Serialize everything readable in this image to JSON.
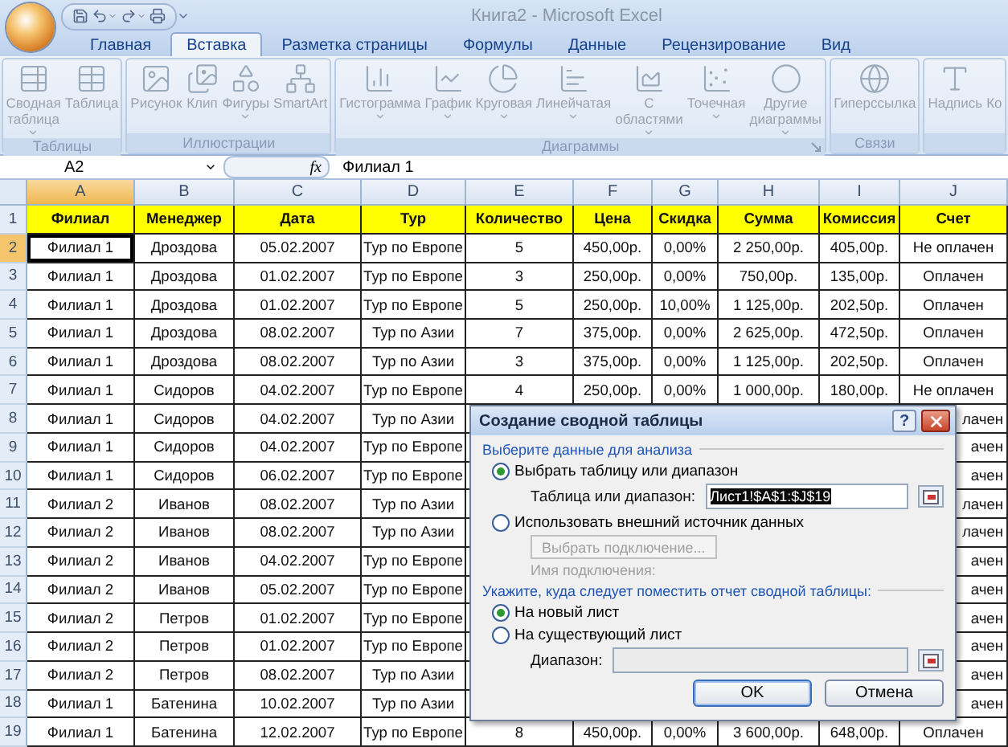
{
  "window": {
    "title": "Книга2 - Microsoft Excel"
  },
  "ribbon_tabs": [
    {
      "label": "Главная",
      "selected": false
    },
    {
      "label": "Вставка",
      "selected": true
    },
    {
      "label": "Разметка страницы",
      "selected": false
    },
    {
      "label": "Формулы",
      "selected": false
    },
    {
      "label": "Данные",
      "selected": false
    },
    {
      "label": "Рецензирование",
      "selected": false
    },
    {
      "label": "Вид",
      "selected": false
    }
  ],
  "ribbon_groups": [
    {
      "label": "Таблицы",
      "launcher": false,
      "items": [
        {
          "label": "Сводная таблица",
          "dropdown": true
        },
        {
          "label": "Таблица",
          "dropdown": false
        }
      ]
    },
    {
      "label": "Иллюстрации",
      "launcher": false,
      "items": [
        {
          "label": "Рисунок",
          "dropdown": false
        },
        {
          "label": "Клип",
          "dropdown": false
        },
        {
          "label": "Фигуры",
          "dropdown": true
        },
        {
          "label": "SmartArt",
          "dropdown": false
        }
      ]
    },
    {
      "label": "Диаграммы",
      "launcher": true,
      "items": [
        {
          "label": "Гистограмма",
          "dropdown": true
        },
        {
          "label": "График",
          "dropdown": true
        },
        {
          "label": "Круговая",
          "dropdown": true
        },
        {
          "label": "Линейчатая",
          "dropdown": true
        },
        {
          "label": "С областями",
          "dropdown": true
        },
        {
          "label": "Точечная",
          "dropdown": true
        },
        {
          "label": "Другие диаграммы",
          "dropdown": true
        }
      ]
    },
    {
      "label": "Связи",
      "launcher": false,
      "items": [
        {
          "label": "Гиперссылка",
          "dropdown": false
        }
      ]
    },
    {
      "launcher": false,
      "items": [
        {
          "label": "Надпись",
          "dropdown": false
        },
        {
          "label": "Ко",
          "dropdown": false
        }
      ]
    }
  ],
  "formula_bar": {
    "name_box": "A2",
    "function_label": "fx",
    "formula": "Филиал 1"
  },
  "columns": [
    {
      "label": "A",
      "selected": true
    },
    {
      "label": "B",
      "selected": false
    },
    {
      "label": "C",
      "selected": false
    },
    {
      "label": "D",
      "selected": false
    },
    {
      "label": "E",
      "selected": false
    },
    {
      "label": "F",
      "selected": false
    },
    {
      "label": "G",
      "selected": false
    },
    {
      "label": "H",
      "selected": false
    },
    {
      "label": "I",
      "selected": false
    },
    {
      "label": "J",
      "selected": false
    }
  ],
  "rows": [
    {
      "number": "1",
      "kind": "header",
      "selected": false,
      "covered": false,
      "cells": [
        "Филиал",
        "Менеджер",
        "Дата",
        "Тур",
        "Количество",
        "Цена",
        "Скидка",
        "Сумма",
        "Комиссия",
        "Счет"
      ]
    },
    {
      "number": "2",
      "kind": "data",
      "selected": true,
      "covered": false,
      "cells": [
        "Филиал 1",
        "Дроздова",
        "05.02.2007",
        "Тур по Европе",
        "5",
        "450,00р.",
        "0,00%",
        "2 250,00р.",
        "405,00р.",
        "Не оплачен"
      ]
    },
    {
      "number": "3",
      "kind": "data",
      "selected": false,
      "covered": false,
      "cells": [
        "Филиал 1",
        "Дроздова",
        "01.02.2007",
        "Тур по Европе",
        "3",
        "250,00р.",
        "0,00%",
        "750,00р.",
        "135,00р.",
        "Оплачен"
      ]
    },
    {
      "number": "4",
      "kind": "data",
      "selected": false,
      "covered": false,
      "cells": [
        "Филиал 1",
        "Дроздова",
        "01.02.2007",
        "Тур по Европе",
        "5",
        "250,00р.",
        "10,00%",
        "1 125,00р.",
        "202,50р.",
        "Оплачен"
      ]
    },
    {
      "number": "5",
      "kind": "data",
      "selected": false,
      "covered": false,
      "cells": [
        "Филиал 1",
        "Дроздова",
        "08.02.2007",
        "Тур по Азии",
        "7",
        "375,00р.",
        "0,00%",
        "2 625,00р.",
        "472,50р.",
        "Оплачен"
      ]
    },
    {
      "number": "6",
      "kind": "data",
      "selected": false,
      "covered": false,
      "cells": [
        "Филиал 1",
        "Дроздова",
        "08.02.2007",
        "Тур по Азии",
        "3",
        "375,00р.",
        "0,00%",
        "1 125,00р.",
        "202,50р.",
        "Оплачен"
      ]
    },
    {
      "number": "7",
      "kind": "data",
      "selected": false,
      "covered": false,
      "cells": [
        "Филиал 1",
        "Сидоров",
        "04.02.2007",
        "Тур по Европе",
        "4",
        "250,00р.",
        "0,00%",
        "1 000,00р.",
        "180,00р.",
        "Не оплачен"
      ]
    },
    {
      "number": "8",
      "kind": "data",
      "selected": false,
      "covered": true,
      "cells": [
        "Филиал 1",
        "Сидоров",
        "04.02.2007",
        "Тур по Азии",
        null,
        null,
        null,
        null,
        null,
        "лачен"
      ]
    },
    {
      "number": "9",
      "kind": "data",
      "selected": false,
      "covered": true,
      "cells": [
        "Филиал 1",
        "Сидоров",
        "04.02.2007",
        "Тур по Европе",
        null,
        null,
        null,
        null,
        null,
        "ачен"
      ]
    },
    {
      "number": "10",
      "kind": "data",
      "selected": false,
      "covered": true,
      "cells": [
        "Филиал 1",
        "Сидоров",
        "06.02.2007",
        "Тур по Европе",
        null,
        null,
        null,
        null,
        null,
        "ачен"
      ]
    },
    {
      "number": "11",
      "kind": "data",
      "selected": false,
      "covered": true,
      "cells": [
        "Филиал 2",
        "Иванов",
        "08.02.2007",
        "Тур по Азии",
        null,
        null,
        null,
        null,
        null,
        "лачен"
      ]
    },
    {
      "number": "12",
      "kind": "data",
      "selected": false,
      "covered": true,
      "cells": [
        "Филиал 2",
        "Иванов",
        "08.02.2007",
        "Тур по Азии",
        null,
        null,
        null,
        null,
        null,
        "лачен"
      ]
    },
    {
      "number": "13",
      "kind": "data",
      "selected": false,
      "covered": true,
      "cells": [
        "Филиал 2",
        "Иванов",
        "04.02.2007",
        "Тур по Европе",
        null,
        null,
        null,
        null,
        null,
        "ачен"
      ]
    },
    {
      "number": "14",
      "kind": "data",
      "selected": false,
      "covered": true,
      "cells": [
        "Филиал 2",
        "Иванов",
        "05.02.2007",
        "Тур по Европе",
        null,
        null,
        null,
        null,
        null,
        "ачен"
      ]
    },
    {
      "number": "15",
      "kind": "data",
      "selected": false,
      "covered": true,
      "cells": [
        "Филиал 2",
        "Петров",
        "01.02.2007",
        "Тур по Европе",
        null,
        null,
        null,
        null,
        null,
        "ачен"
      ]
    },
    {
      "number": "16",
      "kind": "data",
      "selected": false,
      "covered": true,
      "cells": [
        "Филиал 2",
        "Петров",
        "01.02.2007",
        "Тур по Европе",
        null,
        null,
        null,
        null,
        null,
        "ачен"
      ]
    },
    {
      "number": "17",
      "kind": "data",
      "selected": false,
      "covered": true,
      "cells": [
        "Филиал 2",
        "Петров",
        "08.02.2007",
        "Тур по Азии",
        null,
        null,
        null,
        null,
        null,
        "ачен"
      ]
    },
    {
      "number": "18",
      "kind": "data",
      "selected": false,
      "covered": true,
      "cells": [
        "Филиал 1",
        "Батенина",
        "10.02.2007",
        "Тур по Азии",
        null,
        null,
        null,
        null,
        null,
        "ачен"
      ]
    },
    {
      "number": "19",
      "kind": "data",
      "selected": false,
      "covered": false,
      "cells": [
        "Филиал 1",
        "Батенина",
        "12.02.2007",
        "Тур по Европе",
        "8",
        "450,00р.",
        "0,00%",
        "3 600,00р.",
        "648,00р.",
        "Оплачен"
      ]
    }
  ],
  "dialog": {
    "title": "Создание сводной таблицы",
    "help_label": "?",
    "source_heading": "Выберите данные для анализа",
    "source_options": [
      {
        "label": "Выбрать таблицу или диапазон",
        "selected": true
      },
      {
        "label": "Использовать внешний источник данных",
        "selected": false
      }
    ],
    "range_label": "Таблица или диапазон:",
    "range_value": "Лист1!$A$1:$J$19",
    "range_value_selected": true,
    "connection_button": {
      "label": "Выбрать подключение...",
      "disabled": true
    },
    "connection_name": {
      "label": "Имя подключения:",
      "disabled": true
    },
    "destination_heading": "Укажите, куда следует поместить отчет сводной таблицы:",
    "destination_options": [
      {
        "label": "На новый лист",
        "selected": true
      },
      {
        "label": "На существующий лист",
        "selected": false
      }
    ],
    "location": {
      "label": "Диапазон:",
      "disabled": true
    },
    "buttons": [
      {
        "label": "OK",
        "default": true
      },
      {
        "label": "Отмена",
        "default": false
      }
    ]
  }
}
